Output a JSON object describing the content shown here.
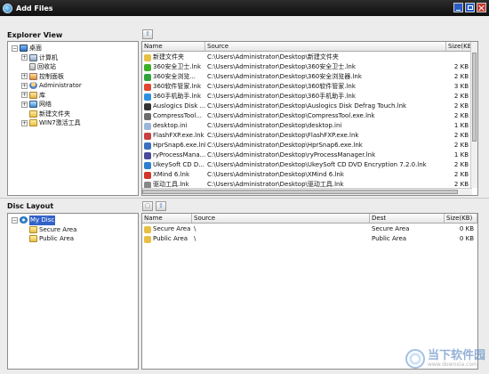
{
  "window": {
    "title": "Add Files"
  },
  "explorer": {
    "title": "Explorer View",
    "tree": [
      {
        "label": "桌面",
        "icon": "desktop-icon",
        "indent": 0,
        "expander": "⊟"
      },
      {
        "label": "计算机",
        "icon": "computer-icon",
        "indent": 1,
        "expander": "⊞"
      },
      {
        "label": "回收站",
        "icon": "recycle-bin-icon",
        "indent": 1,
        "expander": ""
      },
      {
        "label": "控制面板",
        "icon": "control-panel-icon",
        "indent": 1,
        "expander": "⊞"
      },
      {
        "label": "Administrator",
        "icon": "user-icon",
        "indent": 1,
        "expander": "⊞"
      },
      {
        "label": "库",
        "icon": "library-icon",
        "indent": 1,
        "expander": "⊞"
      },
      {
        "label": "网络",
        "icon": "network-icon",
        "indent": 1,
        "expander": "⊞"
      },
      {
        "label": "新建文件夹",
        "icon": "folder-icon",
        "indent": 1,
        "expander": ""
      },
      {
        "label": "WIN7激活工具",
        "icon": "folder-icon",
        "indent": 1,
        "expander": "⊞"
      }
    ],
    "columns": {
      "name": "Name",
      "source": "Source",
      "size": "Size(KB)"
    },
    "files": [
      {
        "name": "新建文件夹",
        "source": "C:\\Users\\Administrator\\Desktop\\新建文件夹",
        "size": "",
        "color": "#e8bf45"
      },
      {
        "name": "360安全卫士.lnk",
        "source": "C:\\Users\\Administrator\\Desktop\\360安全卫士.lnk",
        "size": "2 KB",
        "color": "#3fae2a"
      },
      {
        "name": "360安全浏览...",
        "source": "C:\\Users\\Administrator\\Desktop\\360安全浏览器.lnk",
        "size": "2 KB",
        "color": "#2fa33a"
      },
      {
        "name": "360软件管家.lnk",
        "source": "C:\\Users\\Administrator\\Desktop\\360软件管家.lnk",
        "size": "3 KB",
        "color": "#e0452e"
      },
      {
        "name": "360手机助手.lnk",
        "source": "C:\\Users\\Administrator\\Desktop\\360手机助手.lnk",
        "size": "2 KB",
        "color": "#2e8fe0"
      },
      {
        "name": "Auslogics Disk ...",
        "source": "C:\\Users\\Administrator\\Desktop\\Auslogics Disk Defrag Touch.lnk",
        "size": "2 KB",
        "color": "#333333"
      },
      {
        "name": "CompressTool...",
        "source": "C:\\Users\\Administrator\\Desktop\\CompressTool.exe.lnk",
        "size": "2 KB",
        "color": "#6b6b6b"
      },
      {
        "name": "desktop.ini",
        "source": "C:\\Users\\Administrator\\Desktop\\desktop.ini",
        "size": "1 KB",
        "color": "#9ab6d8"
      },
      {
        "name": "FlashFXP.exe.lnk",
        "source": "C:\\Users\\Administrator\\Desktop\\FlashFXP.exe.lnk",
        "size": "2 KB",
        "color": "#c94040"
      },
      {
        "name": "HprSnap6.exe.lnk",
        "source": "C:\\Users\\Administrator\\Desktop\\HprSnap6.exe.lnk",
        "size": "2 KB",
        "color": "#3a6fc0"
      },
      {
        "name": "ryProcessMana...",
        "source": "C:\\Users\\Administrator\\Desktop\\ryProcessManager.lnk",
        "size": "1 KB",
        "color": "#4a4a9a"
      },
      {
        "name": "UkeySoft CD D...",
        "source": "C:\\Users\\Administrator\\Desktop\\UkeySoft CD DVD Encryption 7.2.0.lnk",
        "size": "2 KB",
        "color": "#2c7fd0"
      },
      {
        "name": "XMind 6.lnk",
        "source": "C:\\Users\\Administrator\\Desktop\\XMind 6.lnk",
        "size": "2 KB",
        "color": "#d2352b"
      },
      {
        "name": "驱动工具.lnk",
        "source": "C:\\Users\\Administrator\\Desktop\\驱动工具.lnk",
        "size": "2 KB",
        "color": "#888888"
      }
    ]
  },
  "disc": {
    "title": "Disc Layout",
    "tree": [
      {
        "label": "My Disc",
        "icon": "disc-icon",
        "indent": 0,
        "expander": "⊟"
      },
      {
        "label": "Secure Area",
        "icon": "folder-icon",
        "indent": 1,
        "expander": ""
      },
      {
        "label": "Public Area",
        "icon": "folder-icon",
        "indent": 1,
        "expander": ""
      }
    ],
    "columns": {
      "name": "Name",
      "source": "Source",
      "dest": "Dest",
      "size": "Size(KB)"
    },
    "files": [
      {
        "name": "Secure Area",
        "source": "\\",
        "dest": "Secure Area",
        "size": "0 KB"
      },
      {
        "name": "Public Area",
        "source": "\\",
        "dest": "Public Area",
        "size": "0 KB"
      }
    ]
  },
  "watermark": {
    "text": "当下软件园",
    "sub": "www.downxia.com"
  }
}
